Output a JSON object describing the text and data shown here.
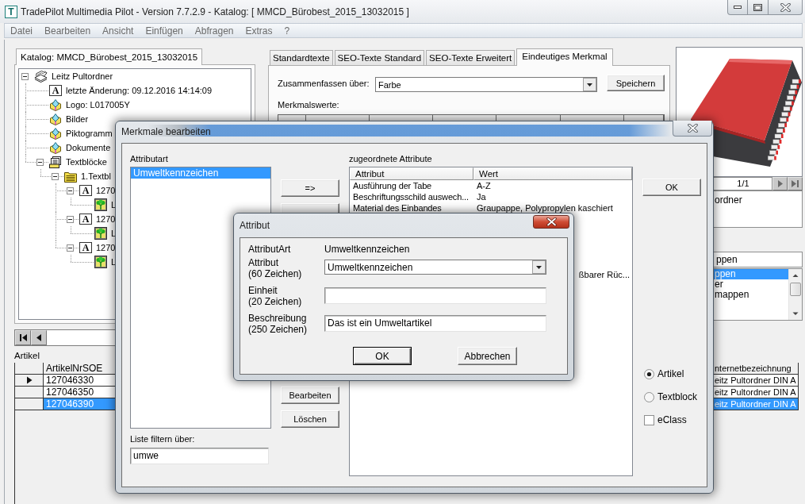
{
  "window": {
    "icon_text": "T",
    "title": "TradePilot Multimedia Pilot - Version 7.7.2.9 - Katalog: [ MMCD_Bürobest_2015_13032015 ]"
  },
  "menu": [
    "Datei",
    "Bearbeiten",
    "Ansicht",
    "Einfügen",
    "Abfragen",
    "Extras",
    "?"
  ],
  "catalog_tab": {
    "label": "Katalog: MMCD_Bürobest_2015_13032015"
  },
  "tree": {
    "label": "Leitz Pultordner",
    "kind": "catalog",
    "expanded": true,
    "children": [
      {
        "label": "letzte Änderung: 09.12.2016 14:14:09",
        "kind": "text",
        "icon_text": "A"
      },
      {
        "label": "Logo: L017005Y",
        "kind": "media"
      },
      {
        "label": "Bilder",
        "kind": "media"
      },
      {
        "label": "Piktogramm",
        "kind": "media"
      },
      {
        "label": "Dokumente",
        "kind": "media"
      },
      {
        "label": "Textblöcke",
        "kind": "textblocks",
        "expanded": true,
        "children": [
          {
            "label": "1.Textbl",
            "kind": "folder",
            "expanded": true,
            "children": [
              {
                "label": "1270",
                "kind": "text",
                "icon_text": "A",
                "expanded": true,
                "children": [
                  {
                    "label": "L",
                    "kind": "image"
                  }
                ]
              },
              {
                "label": "1270",
                "kind": "text",
                "icon_text": "A",
                "expanded": true,
                "children": [
                  {
                    "label": "L",
                    "kind": "image"
                  }
                ]
              },
              {
                "label": "1270",
                "kind": "text",
                "icon_text": "A",
                "expanded": true,
                "children": [
                  {
                    "label": "L",
                    "kind": "image"
                  }
                ]
              }
            ]
          }
        ]
      }
    ]
  },
  "tabs": [
    {
      "label": "Standardtexte",
      "selected": false
    },
    {
      "label": "SEO-Texte Standard",
      "selected": false
    },
    {
      "label": "SEO-Texte Erweitert",
      "selected": false
    },
    {
      "label": "Eindeutiges Merkmal",
      "selected": true
    }
  ],
  "merge_by": {
    "label": "Zusammenfassen über:",
    "value": "Farbe",
    "button": "Speichern"
  },
  "feature_values": {
    "label": "Merkmalswerte:"
  },
  "preview": {
    "page": "1/1",
    "caption": "ordner"
  },
  "search_field": {
    "value": "ppen"
  },
  "search_list": [
    {
      "label": "ppen",
      "selected": true
    },
    {
      "label": "er",
      "selected": false
    },
    {
      "label": "mappen",
      "selected": false
    }
  ],
  "artikel": {
    "label": "Artikel",
    "columns": [
      "ArtikelNrSOE",
      "nternetbezeichnung"
    ],
    "rows": [
      {
        "current": true,
        "selected": false,
        "cells": [
          "127046330",
          "eitz Pultordner DIN A"
        ]
      },
      {
        "current": false,
        "selected": false,
        "cells": [
          "127046350",
          "eitz Pultordner DIN A"
        ]
      },
      {
        "current": false,
        "selected": true,
        "cells": [
          "127046390",
          "eitz Pultordner DIN A"
        ]
      }
    ]
  },
  "features_dialog": {
    "title": "Merkmale bearbeiten",
    "type_label": "Attributart",
    "types": [
      {
        "label": "Umweltkennzeichen",
        "selected": true
      }
    ],
    "filter_label": "Liste filtern über:",
    "filter_value": "umwe",
    "buttons_top": [
      "=>"
    ],
    "buttons_bottom": [
      "Bearbeiten",
      "Löschen"
    ],
    "assigned_label": "zugeordnete Attribute",
    "assigned_columns": [
      "Attribut",
      "Wert"
    ],
    "assigned_rows": [
      {
        "attribut": "Ausführung der Tabe",
        "wert": "A-Z"
      },
      {
        "attribut": "Beschriftungsschild auswech...",
        "wert": "Ja"
      },
      {
        "attribut": "Material des Einbandes",
        "wert": "Graupappe, Polypropylen kaschiert"
      },
      {
        "wert": "ßbarer Rüc..."
      }
    ],
    "ok_button": "OK",
    "options": [
      {
        "kind": "radio",
        "label": "Artikel",
        "checked": true
      },
      {
        "kind": "radio",
        "label": "Textblock",
        "checked": false
      },
      {
        "kind": "checkbox",
        "label": "eClass",
        "checked": false
      }
    ]
  },
  "attribute_dialog": {
    "title": "Attribut",
    "fields": [
      {
        "kind": "static",
        "label": "AttributArt",
        "value": "Umweltkennzeichen"
      },
      {
        "kind": "combo",
        "label": "Attribut",
        "hint": "(60 Zeichen)",
        "value": "Umweltkennzeichen"
      },
      {
        "kind": "text",
        "label": "Einheit",
        "hint": "(20 Zeichen)"
      },
      {
        "kind": "text",
        "label": "Beschreibung",
        "hint": "(250 Zeichen)",
        "value": "Das ist ein Umweltartikel"
      }
    ],
    "buttons": [
      {
        "label": "OK",
        "default": true
      },
      {
        "label": "Abbrechen",
        "default": false
      }
    ]
  }
}
